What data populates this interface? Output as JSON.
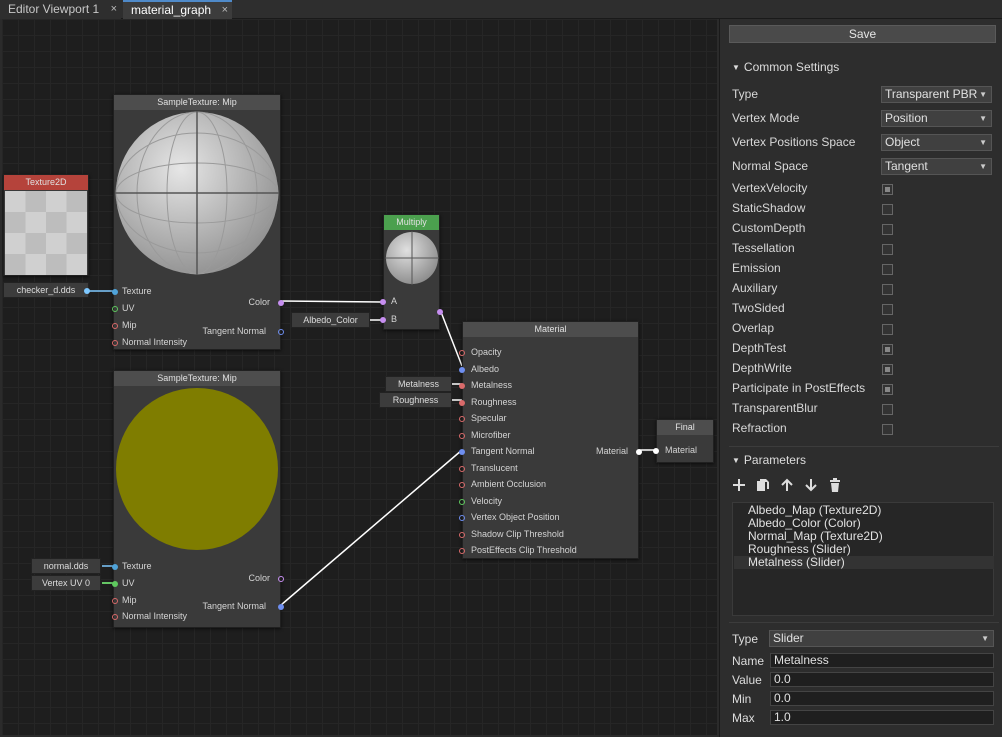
{
  "tabs": [
    {
      "label": "Editor Viewport 1",
      "close": "×"
    },
    {
      "label": "material_graph",
      "close": "×"
    }
  ],
  "graph": {
    "texture2d": {
      "title": "Texture2D",
      "file": "checker_d.dds"
    },
    "sample1": {
      "title": "SampleTexture: Mip",
      "inputs": [
        "Texture",
        "UV",
        "Mip",
        "Normal Intensity"
      ],
      "outputs": [
        "Color",
        "Tangent Normal"
      ]
    },
    "sample2": {
      "title": "SampleTexture: Mip",
      "inputs": [
        "Texture",
        "UV",
        "Mip",
        "Normal Intensity"
      ],
      "outputs": [
        "Color",
        "Tangent Normal"
      ],
      "texture_const": "normal.dds",
      "uv_const": "Vertex UV 0"
    },
    "multiply": {
      "title": "Multiply",
      "inputs": [
        "A",
        "B"
      ],
      "b_const": "Albedo_Color"
    },
    "material": {
      "title": "Material",
      "inputs": [
        "Opacity",
        "Albedo",
        "Metalness",
        "Roughness",
        "Specular",
        "Microfiber",
        "Tangent Normal",
        "Translucent",
        "Ambient Occlusion",
        "Velocity",
        "Vertex Object Position",
        "Shadow Clip Threshold",
        "PostEffects Clip Threshold"
      ],
      "output": "Material",
      "metalness_const": "Metalness",
      "roughness_const": "Roughness"
    },
    "final": {
      "title": "Final",
      "input": "Material"
    }
  },
  "panel": {
    "save_label": "Save",
    "common_settings_title": "Common Settings",
    "dropdowns": [
      {
        "label": "Type",
        "value": "Transparent PBR"
      },
      {
        "label": "Vertex Mode",
        "value": "Position"
      },
      {
        "label": "Vertex Positions Space",
        "value": "Object"
      },
      {
        "label": "Normal Space",
        "value": "Tangent"
      }
    ],
    "checkboxes": [
      {
        "label": "VertexVelocity",
        "checked": true
      },
      {
        "label": "StaticShadow",
        "checked": false
      },
      {
        "label": "CustomDepth",
        "checked": false
      },
      {
        "label": "Tessellation",
        "checked": false
      },
      {
        "label": "Emission",
        "checked": false
      },
      {
        "label": "Auxiliary",
        "checked": false
      },
      {
        "label": "TwoSided",
        "checked": false
      },
      {
        "label": "Overlap",
        "checked": false
      },
      {
        "label": "DepthTest",
        "checked": true
      },
      {
        "label": "DepthWrite",
        "checked": true
      },
      {
        "label": "Participate in PostEffects",
        "checked": true
      },
      {
        "label": "TransparentBlur",
        "checked": false
      },
      {
        "label": "Refraction",
        "checked": false
      }
    ],
    "parameters_title": "Parameters",
    "toolbar_icons": [
      "plus-icon",
      "copy-icon",
      "arrow-up-icon",
      "arrow-down-icon",
      "trash-icon"
    ],
    "parameters": [
      "Albedo_Map (Texture2D)",
      "Albedo_Color (Color)",
      "Normal_Map (Texture2D)",
      "Roughness (Slider)",
      "Metalness (Slider)"
    ],
    "selected_parameter": 4,
    "param_type": {
      "label": "Type",
      "value": "Slider"
    },
    "fields": [
      {
        "label": "Name",
        "value": "Metalness"
      },
      {
        "label": "Value",
        "value": "0.0"
      },
      {
        "label": "Min",
        "value": "0.0"
      },
      {
        "label": "Max",
        "value": "1.0"
      }
    ]
  },
  "colors": {
    "accent": "#4f8ac9",
    "texture_header": "#b5433b",
    "multiply_header": "#4ba04e",
    "yellow_preview": "#7f7d00"
  }
}
